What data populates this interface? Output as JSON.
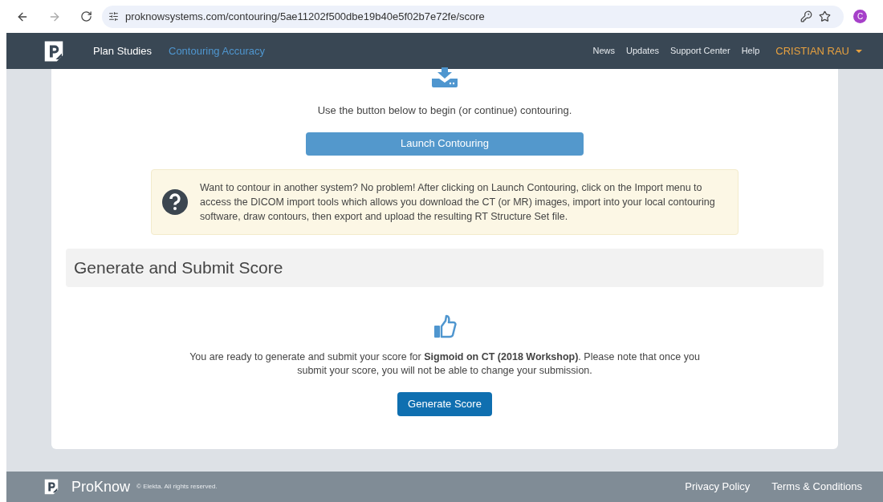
{
  "browser": {
    "url": "proknowsystems.com/contouring/5ae11202f500dbe19b40e5f02b7e72fe/score",
    "profile_initial": "C"
  },
  "nav": {
    "links": [
      {
        "label": "Plan Studies",
        "selected": false
      },
      {
        "label": "Contouring Accuracy",
        "selected": true
      }
    ],
    "right_links": [
      "News",
      "Updates",
      "Support Center",
      "Help"
    ],
    "user": "CRISTIAN RAU"
  },
  "contour": {
    "instruction": "Use the button below to begin (or continue) contouring.",
    "launch_button": "Launch Contouring",
    "notice": "Want to contour in another system? No problem! After clicking on Launch Contouring, click on the Import menu to access the DICOM import tools which allows you download the CT (or MR) images, import into your local contouring software, draw contours, then export and upload the resulting RT Structure Set file."
  },
  "score": {
    "heading": "Generate and Submit Score",
    "message": "You are ready to generate and submit your score for **Sigmoid on CT (2018 Workshop)**. Please note that once you submit your score, you will not be able to change your submission.",
    "button": "Generate Score"
  },
  "footer": {
    "brand": "ProKnow",
    "copyright": "© Elekta. All rights reserved.",
    "links": [
      "Privacy Policy",
      "Terms & Conditions"
    ]
  }
}
